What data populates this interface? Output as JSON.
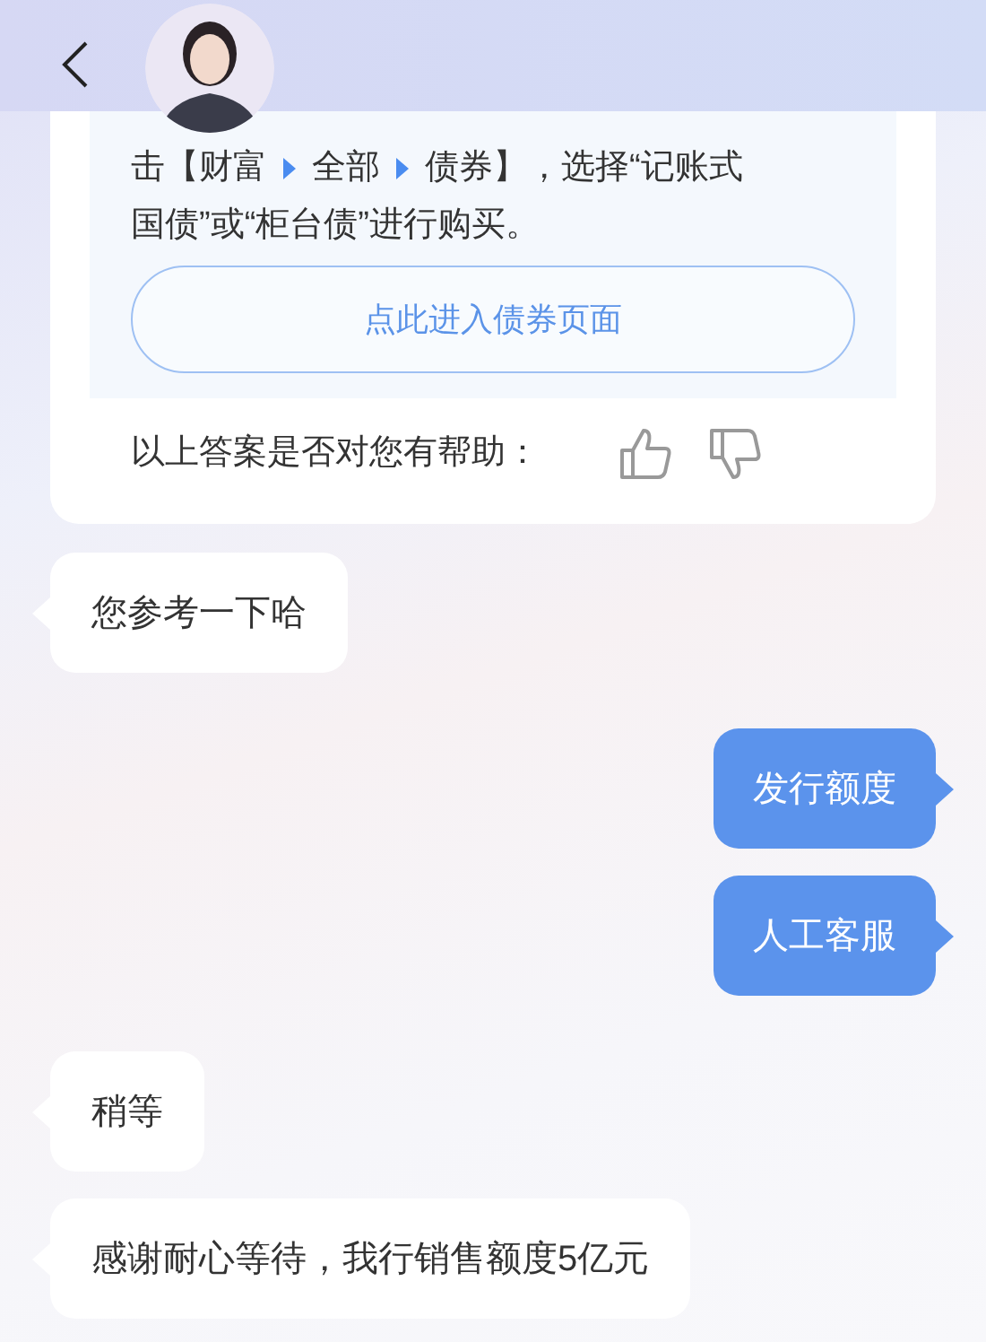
{
  "answer": {
    "lines": [
      [
        "击【财富",
        "全部",
        "债券】，选择“记账式"
      ],
      [
        "国债”或“柜台债”进行购买。"
      ]
    ],
    "link_button": "点此进入债券页面",
    "feedback_prompt": "以上答案是否对您有帮助："
  },
  "messages": [
    {
      "kind": "bot",
      "text": "您参考一下哈"
    },
    {
      "kind": "user",
      "text": "发行额度"
    },
    {
      "kind": "user",
      "text": "人工客服"
    },
    {
      "kind": "bot",
      "text": "稍等"
    },
    {
      "kind": "bot",
      "text": "感谢耐心等待，我行销售额度5亿元"
    }
  ]
}
